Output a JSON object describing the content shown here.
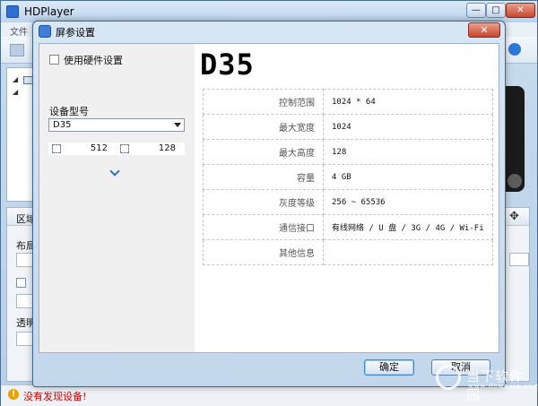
{
  "main": {
    "title": "HDPlayer",
    "menu_first": "文件",
    "window_controls": {
      "minimize": "—",
      "maximize": "□",
      "close": "✕"
    },
    "lower_panel": {
      "header": "区域",
      "layout_label": "布局",
      "transparency_label": "透明"
    },
    "status": {
      "icon": "!",
      "text": "没有发现设备!"
    }
  },
  "dialog": {
    "title": "屏参设置",
    "close_label": "✕",
    "sidebar": {
      "hardware_label": "使用硬件设置",
      "model_label": "设备型号",
      "model_value": "D35",
      "width_value": "512",
      "height_value": "128"
    },
    "heading": "D35",
    "specs": [
      {
        "key": "控制范围",
        "value": "1024 * 64"
      },
      {
        "key": "最大宽度",
        "value": "1024"
      },
      {
        "key": "最大高度",
        "value": "128"
      },
      {
        "key": "容量",
        "value": "4 GB"
      },
      {
        "key": "灰度等级",
        "value": "256 ~ 65536"
      },
      {
        "key": "通信接口",
        "value": "有线网络 / U 盘 / 3G / 4G / Wi-Fi"
      },
      {
        "key": "其他信息",
        "value": ""
      }
    ],
    "ok_label": "确定",
    "cancel_label": "取消"
  },
  "watermark": {
    "text": "当下软件园",
    "url": "www.downxia.com"
  },
  "colors": {
    "accent": "#2d72c7",
    "status_text": "#d00000",
    "close_button": "#c8452c"
  }
}
